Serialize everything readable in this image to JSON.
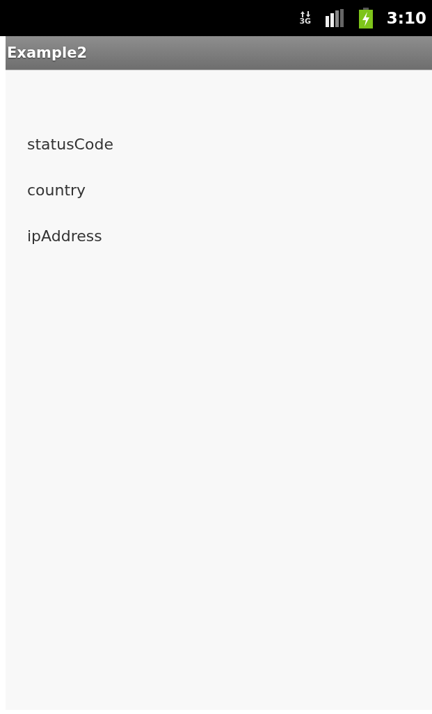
{
  "status_bar": {
    "network_type": "3G",
    "time": "3:10"
  },
  "title_bar": {
    "title": "Example2"
  },
  "items": [
    {
      "label": "statusCode"
    },
    {
      "label": "country"
    },
    {
      "label": "ipAddress"
    }
  ]
}
